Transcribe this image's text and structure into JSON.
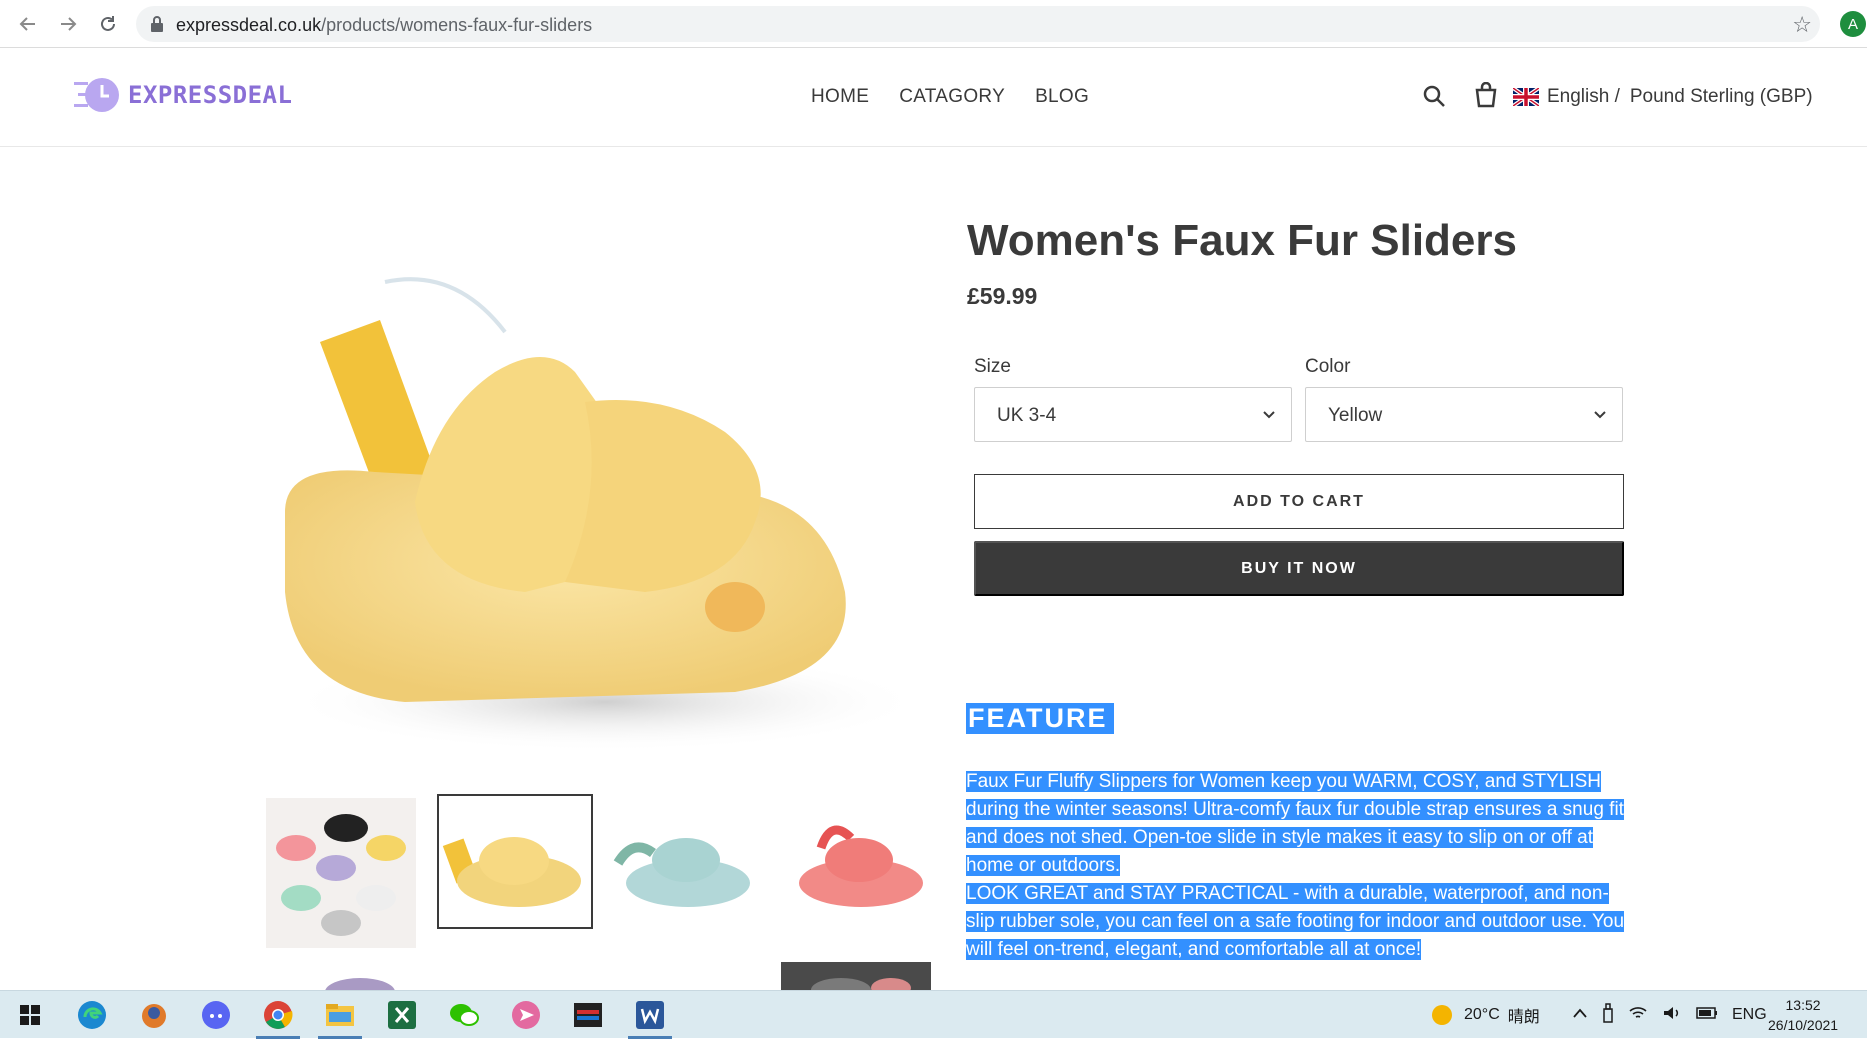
{
  "browser": {
    "url_domain": "expressdeal.co.uk",
    "url_path": "/products/womens-faux-fur-sliders",
    "profile_initial": "A"
  },
  "header": {
    "logo_text": "EXPRESSDEAL",
    "nav": [
      "HOME",
      "CATAGORY",
      "BLOG"
    ],
    "language": "English /",
    "currency": "Pound Sterling (GBP)"
  },
  "product": {
    "title": "Women's Faux Fur Sliders",
    "price": "£59.99",
    "size_label": "Size",
    "size_value": "UK 3-4",
    "color_label": "Color",
    "color_value": "Yellow",
    "add_to_cart": "ADD TO CART",
    "buy_now": "BUY IT NOW",
    "feature_heading": "FEATURE",
    "description_1": "Faux Fur Fluffy Slippers for Women keep you WARM, COSY, and STYLISH during the winter seasons! Ultra-comfy faux fur double strap ensures a snug fit and does not shed. Open-toe slide in style makes it easy to slip on or off at home or outdoors.",
    "description_2": "LOOK GREAT and STAY PRACTICAL - with a durable, waterproof, and non-slip rubber sole, you can feel on a safe footing for indoor and outdoor use. You will feel on-trend, elegant, and comfortable all at once!",
    "selected_thumbnail_index": 2
  },
  "taskbar": {
    "temperature": "20°C",
    "weather": "晴朗",
    "input_lang": "ENG",
    "time": "13:52",
    "date": "26/10/2021",
    "apps": [
      "start-icon",
      "edge-icon",
      "game-icon",
      "discord-icon",
      "chrome-icon",
      "file-explorer-icon",
      "excel-icon",
      "wechat-icon",
      "send-icon",
      "media-icon",
      "word-icon"
    ]
  },
  "colors": {
    "selection": "#3390ff",
    "text": "#3a3a3a",
    "logo": "#8a6fd6",
    "slipper_yellow": "#f6d98a"
  }
}
